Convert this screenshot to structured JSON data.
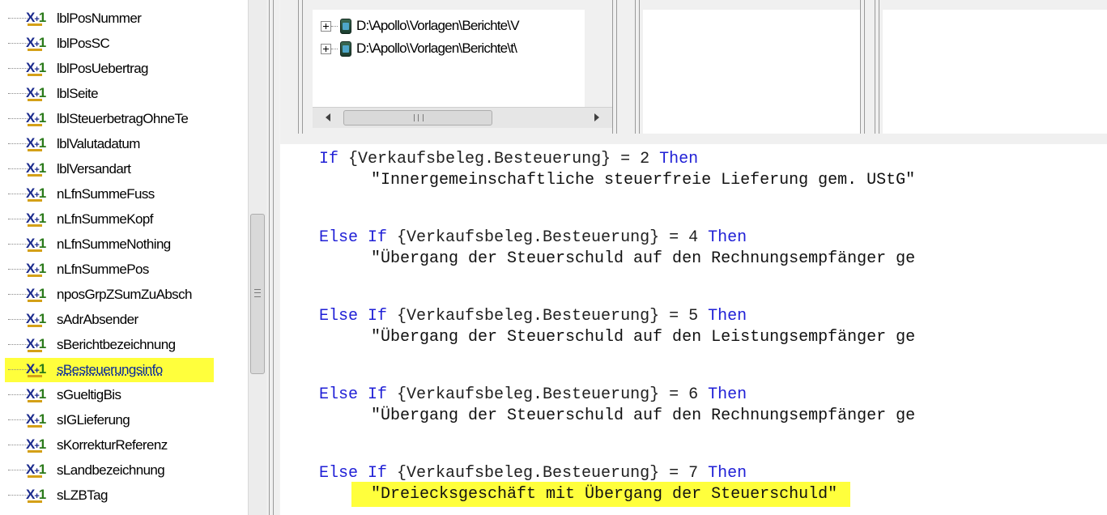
{
  "tree": {
    "items": [
      {
        "label": "lblPosNummer"
      },
      {
        "label": "lblPosSC"
      },
      {
        "label": "lblPosUebertrag"
      },
      {
        "label": "lblSeite"
      },
      {
        "label": "lblSteuerbetragOhneTe"
      },
      {
        "label": "lblValutadatum"
      },
      {
        "label": "lblVersandart"
      },
      {
        "label": "nLfnSummeFuss"
      },
      {
        "label": "nLfnSummeKopf"
      },
      {
        "label": "nLfnSummeNothing"
      },
      {
        "label": "nLfnSummePos"
      },
      {
        "label": "nposGrpZSumZuAbsch"
      },
      {
        "label": "sAdrAbsender"
      },
      {
        "label": "sBerichtbezeichnung"
      },
      {
        "label": "sBesteuerungsinfo",
        "selected": true
      },
      {
        "label": "sGueltigBis"
      },
      {
        "label": "sIGLieferung"
      },
      {
        "label": "sKorrekturReferenz"
      },
      {
        "label": "sLandbezeichnung"
      },
      {
        "label": "sLZBTag"
      }
    ],
    "icon_text": "X",
    "icon_num": "1"
  },
  "file_tree": {
    "rows": [
      {
        "path": "D:\\Apollo\\Vorlagen\\Berichte\\V"
      },
      {
        "path": "D:\\Apollo\\Vorlagen\\Berichte\\t\\"
      }
    ]
  },
  "code": {
    "blocks": [
      {
        "keyword_if": "If",
        "condition": " {Verkaufsbeleg.Besteuerung} = 2 ",
        "keyword_then": "Then",
        "string": "\"Innergemeinschaftliche steuerfreie Lieferung gem. UStG\""
      },
      {
        "keyword_if": "Else If",
        "condition": " {Verkaufsbeleg.Besteuerung} = 4 ",
        "keyword_then": "Then",
        "string": "\"Übergang der Steuerschuld auf den Rechnungsempfänger ge"
      },
      {
        "keyword_if": "Else If",
        "condition": " {Verkaufsbeleg.Besteuerung} = 5 ",
        "keyword_then": "Then",
        "string": "\"Übergang der Steuerschuld auf den Leistungsempfänger ge"
      },
      {
        "keyword_if": "Else If",
        "condition": " {Verkaufsbeleg.Besteuerung} = 6 ",
        "keyword_then": "Then",
        "string": "\"Übergang der Steuerschuld auf den Rechnungsempfänger ge"
      },
      {
        "keyword_if": "Else If",
        "condition": " {Verkaufsbeleg.Besteuerung} = 7 ",
        "keyword_then": "Then",
        "string": "\"Dreiecksgeschäft mit Übergang der Steuerschuld\"",
        "highlighted": true
      }
    ]
  },
  "colors": {
    "keyword": "#1f1fd6",
    "highlight": "#ffff3c"
  }
}
